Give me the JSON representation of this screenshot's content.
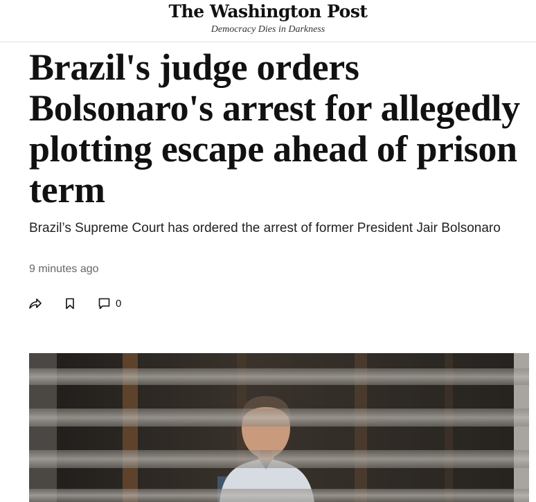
{
  "masthead": {
    "logo": "The Washington Post",
    "tagline": "Democracy Dies in Darkness"
  },
  "article": {
    "headline": "Brazil's judge orders Bolsonaro's arrest for allegedly plotting escape ahead of prison term",
    "subheadline": "Brazil’s Supreme Court has ordered the arrest of former President Jair Bolsonaro",
    "timestamp": "9 minutes ago",
    "comment_count": "0"
  },
  "actions": {
    "icons": [
      "share-icon",
      "bookmark-icon",
      "comment-icon"
    ]
  }
}
